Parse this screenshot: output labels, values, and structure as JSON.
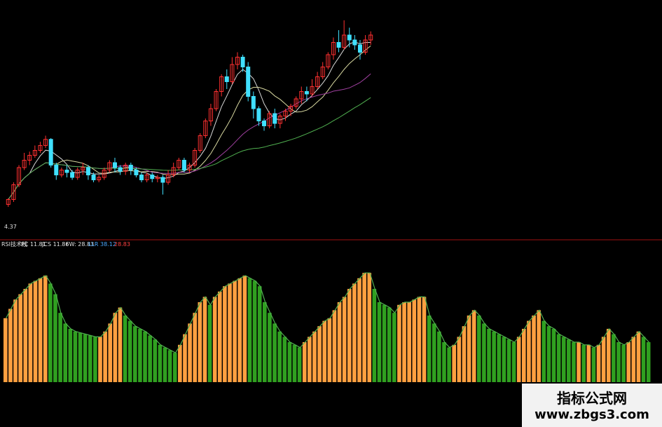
{
  "indicator_legend": {
    "name": "RSI技术线",
    "pc": "PC 11.81",
    "jcs": "JCS 11.86",
    "fw": "FW: 28.83",
    "llr": "LLR 38.12",
    "v": "28.83"
  },
  "price_marker": "4.37",
  "watermark": {
    "title": "指标公式网",
    "url": "www.zbgs3.com"
  },
  "colors": {
    "up": "#ff3030",
    "down": "#40e0ff",
    "ma_white": "#d8d8d8",
    "ma_yellow": "#d8d8a0",
    "ma_purple": "#a040a0",
    "ma_green": "#50b050",
    "ma_blue": "#2020c0",
    "orange": "#ffa040",
    "green_bar": "#30a020",
    "divider": "#a01010"
  },
  "chart_data": [
    {
      "type": "candlestick",
      "title": "",
      "ylim": [
        4.2,
        6.0
      ],
      "candles": [
        [
          4.42,
          4.46,
          4.4,
          4.47
        ],
        [
          4.46,
          4.58,
          4.44,
          4.6
        ],
        [
          4.58,
          4.72,
          4.56,
          4.74
        ],
        [
          4.72,
          4.78,
          4.7,
          4.84
        ],
        [
          4.78,
          4.82,
          4.74,
          4.85
        ],
        [
          4.82,
          4.86,
          4.8,
          4.9
        ],
        [
          4.86,
          4.9,
          4.84,
          4.93
        ],
        [
          4.9,
          4.95,
          4.88,
          4.98
        ],
        [
          4.95,
          4.74,
          4.72,
          4.96
        ],
        [
          4.74,
          4.66,
          4.62,
          4.76
        ],
        [
          4.66,
          4.7,
          4.64,
          4.72
        ],
        [
          4.7,
          4.68,
          4.64,
          4.74
        ],
        [
          4.68,
          4.64,
          4.62,
          4.7
        ],
        [
          4.64,
          4.7,
          4.62,
          4.72
        ],
        [
          4.7,
          4.72,
          4.66,
          4.76
        ],
        [
          4.72,
          4.66,
          4.62,
          4.74
        ],
        [
          4.66,
          4.62,
          4.6,
          4.68
        ],
        [
          4.62,
          4.64,
          4.6,
          4.66
        ],
        [
          4.64,
          4.7,
          4.62,
          4.72
        ],
        [
          4.7,
          4.76,
          4.68,
          4.78
        ],
        [
          4.76,
          4.72,
          4.68,
          4.8
        ],
        [
          4.72,
          4.69,
          4.66,
          4.74
        ],
        [
          4.69,
          4.74,
          4.66,
          4.76
        ],
        [
          4.74,
          4.7,
          4.66,
          4.76
        ],
        [
          4.7,
          4.66,
          4.64,
          4.72
        ],
        [
          4.66,
          4.62,
          4.6,
          4.68
        ],
        [
          4.62,
          4.66,
          4.6,
          4.68
        ],
        [
          4.66,
          4.63,
          4.6,
          4.68
        ],
        [
          4.63,
          4.64,
          4.6,
          4.66
        ],
        [
          4.64,
          4.6,
          4.5,
          4.66
        ],
        [
          4.6,
          4.66,
          4.58,
          4.7
        ],
        [
          4.66,
          4.72,
          4.64,
          4.76
        ],
        [
          4.72,
          4.78,
          4.7,
          4.8
        ],
        [
          4.78,
          4.7,
          4.68,
          4.8
        ],
        [
          4.7,
          4.74,
          4.68,
          4.76
        ],
        [
          4.74,
          4.86,
          4.72,
          4.88
        ],
        [
          4.86,
          4.98,
          4.84,
          5.0
        ],
        [
          4.98,
          5.1,
          4.96,
          5.12
        ],
        [
          5.1,
          5.2,
          5.06,
          5.24
        ],
        [
          5.2,
          5.34,
          5.18,
          5.36
        ],
        [
          5.34,
          5.46,
          5.3,
          5.48
        ],
        [
          5.46,
          5.42,
          5.36,
          5.52
        ],
        [
          5.42,
          5.56,
          5.4,
          5.62
        ],
        [
          5.56,
          5.62,
          5.52,
          5.66
        ],
        [
          5.62,
          5.54,
          5.5,
          5.64
        ],
        [
          5.54,
          5.3,
          5.26,
          5.58
        ],
        [
          5.3,
          5.2,
          5.12,
          5.34
        ],
        [
          5.2,
          5.1,
          5.06,
          5.22
        ],
        [
          5.1,
          5.06,
          5.02,
          5.12
        ],
        [
          5.06,
          5.16,
          5.04,
          5.18
        ],
        [
          5.16,
          5.08,
          5.04,
          5.2
        ],
        [
          5.08,
          5.14,
          5.04,
          5.16
        ],
        [
          5.14,
          5.18,
          5.1,
          5.2
        ],
        [
          5.18,
          5.22,
          5.14,
          5.24
        ],
        [
          5.22,
          5.28,
          5.2,
          5.3
        ],
        [
          5.28,
          5.34,
          5.24,
          5.38
        ],
        [
          5.34,
          5.32,
          5.26,
          5.38
        ],
        [
          5.32,
          5.38,
          5.3,
          5.44
        ],
        [
          5.38,
          5.46,
          5.36,
          5.5
        ],
        [
          5.46,
          5.54,
          5.44,
          5.58
        ],
        [
          5.54,
          5.64,
          5.52,
          5.66
        ],
        [
          5.64,
          5.74,
          5.6,
          5.78
        ],
        [
          5.74,
          5.7,
          5.66,
          5.84
        ],
        [
          5.7,
          5.8,
          5.68,
          5.92
        ],
        [
          5.8,
          5.76,
          5.7,
          5.86
        ],
        [
          5.76,
          5.72,
          5.68,
          5.8
        ],
        [
          5.72,
          5.66,
          5.6,
          5.76
        ],
        [
          5.66,
          5.76,
          5.64,
          5.8
        ],
        [
          5.76,
          5.8,
          5.72,
          5.83
        ]
      ]
    },
    {
      "type": "bar",
      "title": "RSI技术线",
      "ylim": [
        0,
        100
      ],
      "values": [
        48,
        55,
        62,
        66,
        70,
        74,
        76,
        78,
        80,
        74,
        66,
        52,
        44,
        40,
        38,
        37,
        36,
        35,
        34,
        34,
        38,
        44,
        52,
        56,
        50,
        46,
        42,
        40,
        38,
        35,
        32,
        28,
        26,
        24,
        22,
        28,
        36,
        44,
        52,
        60,
        64,
        58,
        64,
        68,
        72,
        74,
        76,
        78,
        80,
        78,
        76,
        72,
        60,
        52,
        44,
        38,
        34,
        30,
        28,
        26,
        30,
        34,
        38,
        42,
        46,
        48,
        54,
        60,
        64,
        70,
        74,
        78,
        82,
        82,
        70,
        60,
        58,
        56,
        52,
        58,
        60,
        60,
        62,
        64,
        64,
        50,
        44,
        38,
        30,
        26,
        28,
        34,
        42,
        50,
        54,
        50,
        44,
        40,
        38,
        36,
        34,
        32,
        30,
        34,
        40,
        46,
        50,
        54,
        46,
        42,
        40,
        36,
        34,
        32,
        30,
        30,
        28,
        28,
        26,
        28,
        34,
        40,
        36,
        30,
        28,
        30,
        34,
        38,
        34,
        30
      ]
    }
  ]
}
